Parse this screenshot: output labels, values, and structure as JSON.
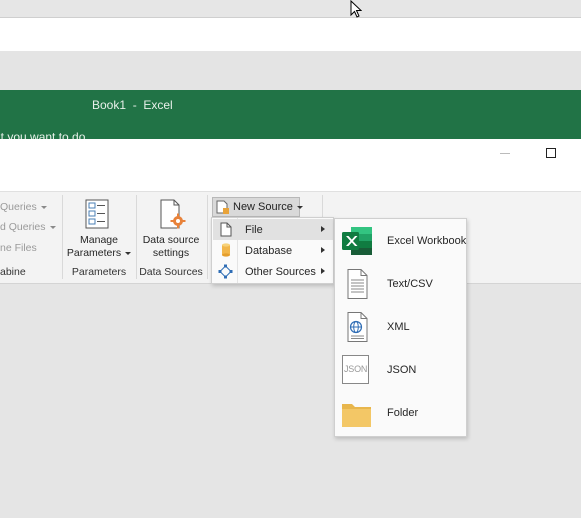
{
  "excel": {
    "title": "Book1  -  Excel",
    "tell_me_hint": "at you want to do"
  },
  "ribbon": {
    "left_group": {
      "items": [
        "Queries",
        "d Queries",
        "ne Files"
      ],
      "label": "abine"
    },
    "parameters_group": {
      "button_label_line1": "Manage",
      "button_label_line2": "Parameters",
      "label": "Parameters"
    },
    "data_sources_group": {
      "button_label_line1": "Data source",
      "button_label_line2": "settings",
      "label": "Data Sources"
    },
    "new_source": {
      "label": "New Source"
    }
  },
  "menu": {
    "items": [
      {
        "label": "File",
        "icon": "file-icon",
        "highlighted": true
      },
      {
        "label": "Database",
        "icon": "database-icon",
        "highlighted": false
      },
      {
        "label": "Other Sources",
        "icon": "other-sources-icon",
        "highlighted": false
      }
    ]
  },
  "submenu": {
    "items": [
      {
        "label": "Excel Workbook",
        "icon": "excel-workbook-icon"
      },
      {
        "label": "Text/CSV",
        "icon": "text-csv-icon"
      },
      {
        "label": "XML",
        "icon": "xml-icon"
      },
      {
        "label": "JSON",
        "icon": "json-icon",
        "icon_text": "JSON"
      },
      {
        "label": "Folder",
        "icon": "folder-icon"
      }
    ]
  },
  "colors": {
    "excel_green": "#217346",
    "accent_orange": "#e8823a",
    "folder_yellow": "#f3c766"
  }
}
